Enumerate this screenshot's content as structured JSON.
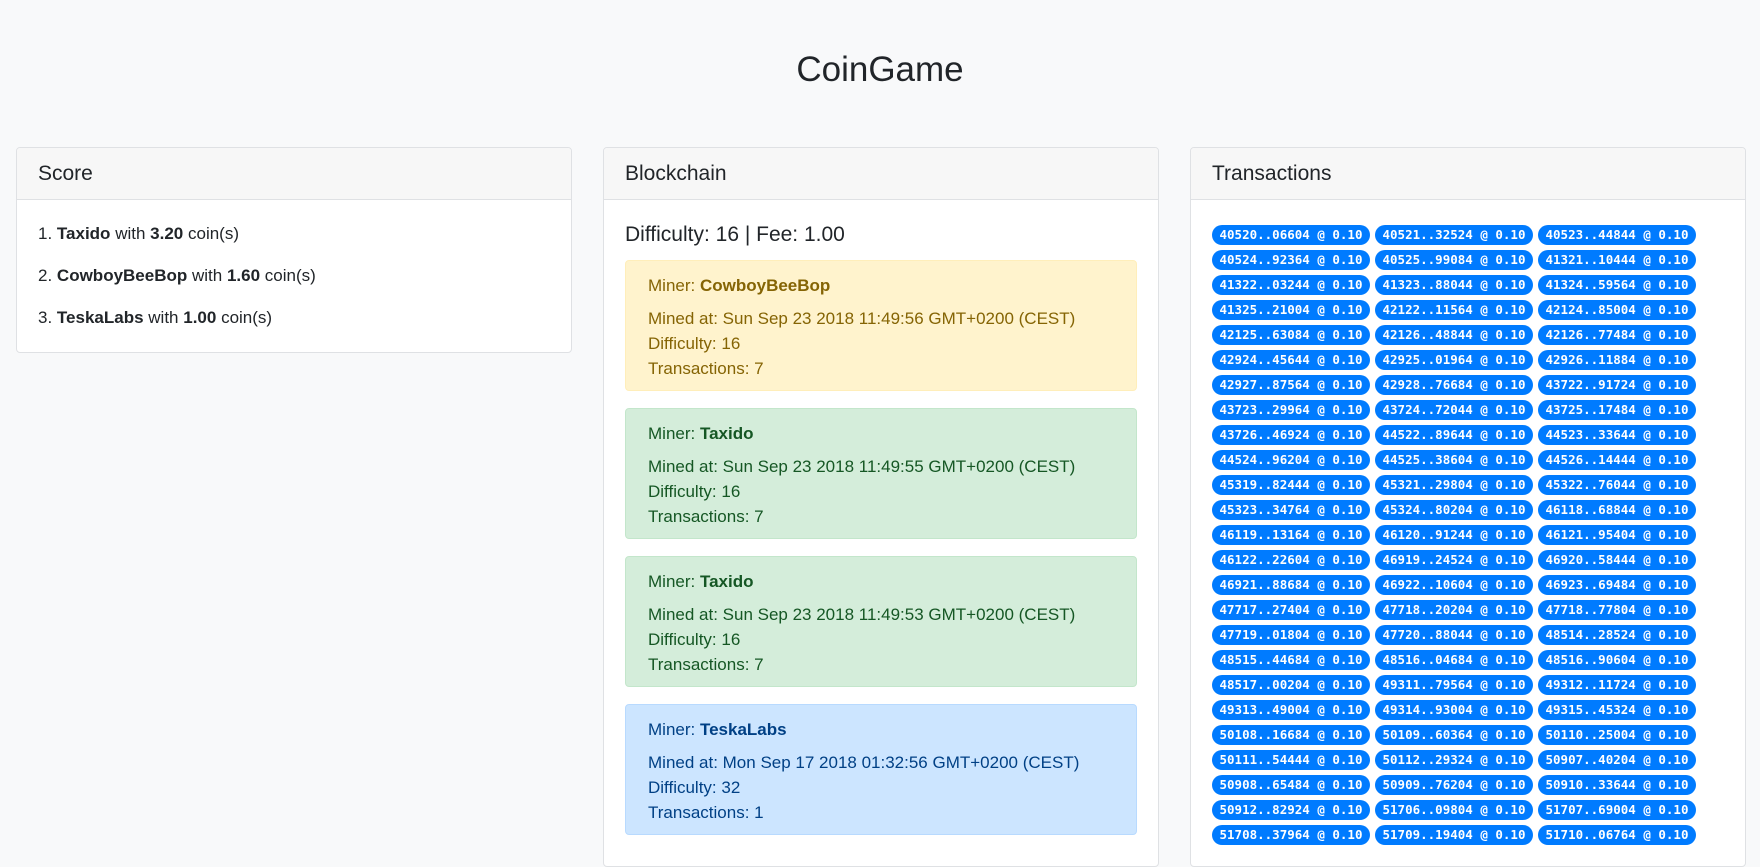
{
  "app": {
    "title": "CoinGame"
  },
  "score": {
    "header": "Score",
    "rows": [
      {
        "rank": "1.",
        "name": "Taxido",
        "with": "with",
        "coins": "3.20",
        "unit": "coin(s)"
      },
      {
        "rank": "2.",
        "name": "CowboyBeeBop",
        "with": "with",
        "coins": "1.60",
        "unit": "coin(s)"
      },
      {
        "rank": "3.",
        "name": "TeskaLabs",
        "with": "with",
        "coins": "1.00",
        "unit": "coin(s)"
      }
    ]
  },
  "blockchain": {
    "header": "Blockchain",
    "summary": "Difficulty: 16 | Fee: 1.00",
    "blocks": [
      {
        "status": "warning",
        "miner_label": "Miner:",
        "miner": "CowboyBeeBop",
        "mined_at": "Mined at: Sun Sep 23 2018 11:49:56 GMT+0200 (CEST)",
        "difficulty": "Difficulty: 16",
        "transactions": "Transactions: 7"
      },
      {
        "status": "success",
        "miner_label": "Miner:",
        "miner": "Taxido",
        "mined_at": "Mined at: Sun Sep 23 2018 11:49:55 GMT+0200 (CEST)",
        "difficulty": "Difficulty: 16",
        "transactions": "Transactions: 7"
      },
      {
        "status": "success",
        "miner_label": "Miner:",
        "miner": "Taxido",
        "mined_at": "Mined at: Sun Sep 23 2018 11:49:53 GMT+0200 (CEST)",
        "difficulty": "Difficulty: 16",
        "transactions": "Transactions: 7"
      },
      {
        "status": "info",
        "miner_label": "Miner:",
        "miner": "TeskaLabs",
        "mined_at": "Mined at: Mon Sep 17 2018 01:32:56 GMT+0200 (CEST)",
        "difficulty": "Difficulty: 32",
        "transactions": "Transactions: 1"
      }
    ]
  },
  "transactions": {
    "header": "Transactions",
    "items": [
      "40520..06604 @ 0.10",
      "40521..32524 @ 0.10",
      "40523..44844 @ 0.10",
      "40524..92364 @ 0.10",
      "40525..99084 @ 0.10",
      "41321..10444 @ 0.10",
      "41322..03244 @ 0.10",
      "41323..88044 @ 0.10",
      "41324..59564 @ 0.10",
      "41325..21004 @ 0.10",
      "42122..11564 @ 0.10",
      "42124..85004 @ 0.10",
      "42125..63084 @ 0.10",
      "42126..48844 @ 0.10",
      "42126..77484 @ 0.10",
      "42924..45644 @ 0.10",
      "42925..01964 @ 0.10",
      "42926..11884 @ 0.10",
      "42927..87564 @ 0.10",
      "42928..76684 @ 0.10",
      "43722..91724 @ 0.10",
      "43723..29964 @ 0.10",
      "43724..72044 @ 0.10",
      "43725..17484 @ 0.10",
      "43726..46924 @ 0.10",
      "44522..89644 @ 0.10",
      "44523..33644 @ 0.10",
      "44524..96204 @ 0.10",
      "44525..38604 @ 0.10",
      "44526..14444 @ 0.10",
      "45319..82444 @ 0.10",
      "45321..29804 @ 0.10",
      "45322..76044 @ 0.10",
      "45323..34764 @ 0.10",
      "45324..80204 @ 0.10",
      "46118..68844 @ 0.10",
      "46119..13164 @ 0.10",
      "46120..91244 @ 0.10",
      "46121..95404 @ 0.10",
      "46122..22604 @ 0.10",
      "46919..24524 @ 0.10",
      "46920..58444 @ 0.10",
      "46921..88684 @ 0.10",
      "46922..10604 @ 0.10",
      "46923..69484 @ 0.10",
      "47717..27404 @ 0.10",
      "47718..20204 @ 0.10",
      "47718..77804 @ 0.10",
      "47719..01804 @ 0.10",
      "47720..88044 @ 0.10",
      "48514..28524 @ 0.10",
      "48515..44684 @ 0.10",
      "48516..04684 @ 0.10",
      "48516..90604 @ 0.10",
      "48517..00204 @ 0.10",
      "49311..79564 @ 0.10",
      "49312..11724 @ 0.10",
      "49313..49004 @ 0.10",
      "49314..93004 @ 0.10",
      "49315..45324 @ 0.10",
      "50108..16684 @ 0.10",
      "50109..60364 @ 0.10",
      "50110..25004 @ 0.10",
      "50111..54444 @ 0.10",
      "50112..29324 @ 0.10",
      "50907..40204 @ 0.10",
      "50908..65484 @ 0.10",
      "50909..76204 @ 0.10",
      "50910..33644 @ 0.10",
      "50912..82924 @ 0.10",
      "51706..09804 @ 0.10",
      "51707..69004 @ 0.10",
      "51708..37964 @ 0.10",
      "51709..19404 @ 0.10",
      "51710..06764 @ 0.10"
    ]
  },
  "colors": {
    "badge": "#007bff",
    "warning_bg": "#fff3cd",
    "success_bg": "#d4edda",
    "info_bg": "#cce5ff"
  }
}
